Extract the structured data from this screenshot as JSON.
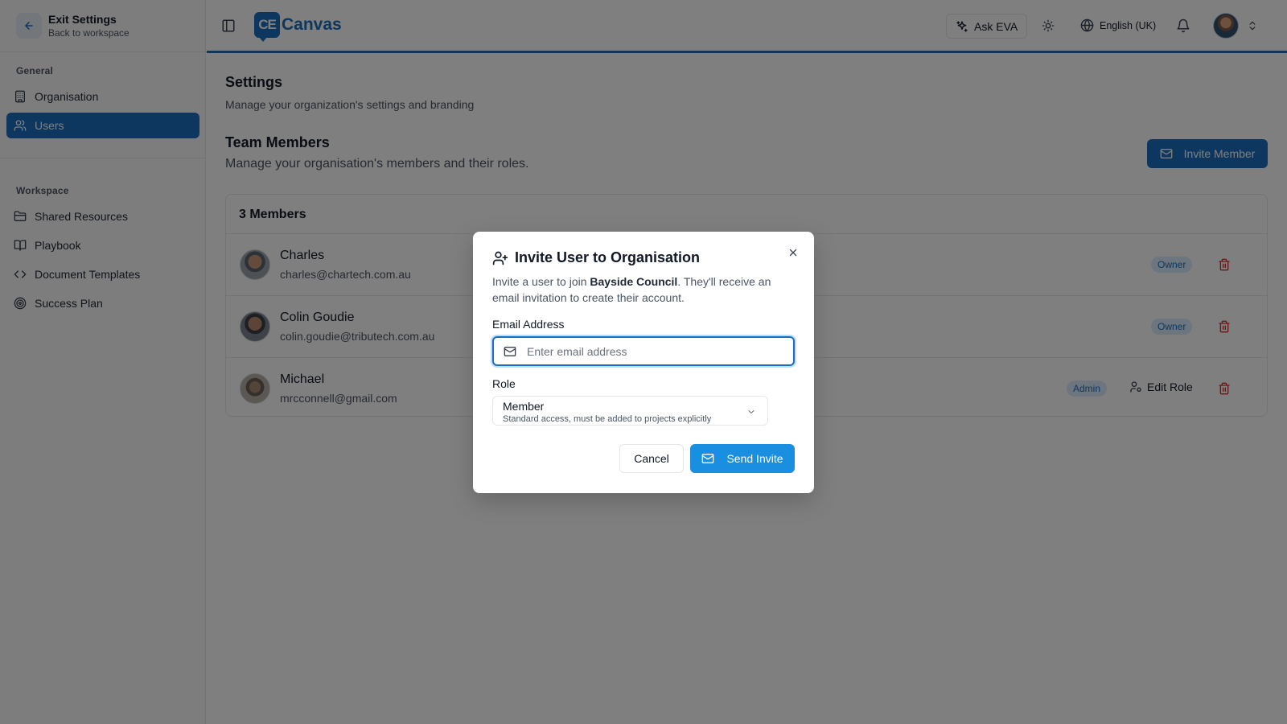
{
  "sidebar": {
    "exit_title": "Exit Settings",
    "exit_subtitle": "Back to workspace",
    "general_label": "General",
    "general_items": [
      {
        "label": "Organisation",
        "icon": "building-icon"
      },
      {
        "label": "Users",
        "icon": "users-icon",
        "active": true
      }
    ],
    "workspace_label": "Workspace",
    "workspace_items": [
      {
        "label": "Shared Resources",
        "icon": "folder-icon"
      },
      {
        "label": "Playbook",
        "icon": "book-icon"
      },
      {
        "label": "Document Templates",
        "icon": "code-icon"
      },
      {
        "label": "Success Plan",
        "icon": "target-icon"
      }
    ]
  },
  "header": {
    "logo_badge": "CE",
    "logo_text": "Canvas",
    "ask_eva_label": "Ask EVA",
    "language": "English (UK)"
  },
  "main": {
    "title": "Settings",
    "subtitle": "Manage your organization's settings and branding",
    "team_title": "Team Members",
    "team_subtitle": "Manage your organisation's members and their roles.",
    "invite_button": "Invite Member",
    "members_count": "3 Members",
    "members": [
      {
        "name": "Charles",
        "email": "charles@chartech.com.au",
        "role": "Owner"
      },
      {
        "name": "Colin Goudie",
        "email": "colin.goudie@tributech.com.au",
        "role": "Owner"
      },
      {
        "name": "Michael",
        "email": "mrcconnell@gmail.com",
        "role": "Admin",
        "action": "Edit Role"
      }
    ]
  },
  "modal": {
    "title": "Invite User to Organisation",
    "desc_prefix": "Invite a user to join ",
    "org_name": "Bayside Council",
    "desc_suffix": ". They'll receive an email invitation to create their account.",
    "email_label": "Email Address",
    "email_placeholder": "Enter email address",
    "email_value": "",
    "role_label": "Role",
    "role_value": "Member",
    "role_description": "Standard access, must be added to projects explicitly",
    "cancel_label": "Cancel",
    "send_label": "Send Invite"
  },
  "colors": {
    "accent": "#1a6fbd",
    "send_button": "#1a8fe0",
    "delete": "#dc2626"
  }
}
